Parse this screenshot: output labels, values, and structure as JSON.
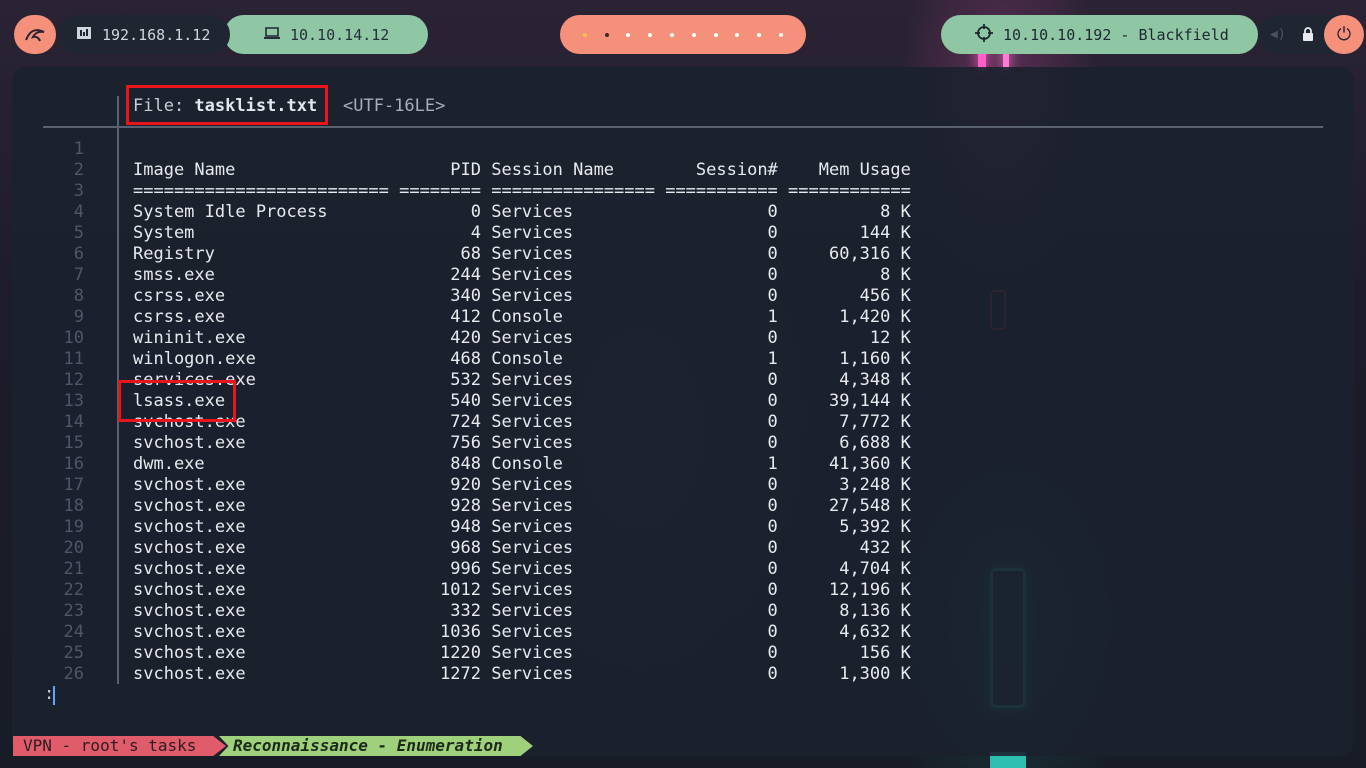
{
  "topbar": {
    "left_ip": "192.168.1.12",
    "vpn_ip": "10.10.14.12",
    "target": "10.10.10.192 - Blackfield",
    "workspaces": [
      "1",
      "2",
      "3",
      "4",
      "5",
      "6",
      "7",
      "8",
      "9",
      "10"
    ],
    "active_workspace": "2"
  },
  "pager": {
    "file_label": "File: ",
    "file_name": "tasklist.txt",
    "encoding": "<UTF-16LE>",
    "prompt": ":"
  },
  "table": {
    "line_numbers": [
      "1",
      "2",
      "3",
      "4",
      "5",
      "6",
      "7",
      "8",
      "9",
      "10",
      "11",
      "12",
      "13",
      "14",
      "15",
      "16",
      "17",
      "18",
      "19",
      "20",
      "21",
      "22",
      "23",
      "24",
      "25",
      "26"
    ],
    "header_line": "Image Name                     PID Session Name        Session#    Mem Usage",
    "separator_line": "========================= ======== ================ =========== ============",
    "rows": [
      {
        "image": "System Idle Process",
        "pid": "0",
        "session": "Services",
        "num": "0",
        "mem": "8 K"
      },
      {
        "image": "System",
        "pid": "4",
        "session": "Services",
        "num": "0",
        "mem": "144 K"
      },
      {
        "image": "Registry",
        "pid": "68",
        "session": "Services",
        "num": "0",
        "mem": "60,316 K"
      },
      {
        "image": "smss.exe",
        "pid": "244",
        "session": "Services",
        "num": "0",
        "mem": "8 K"
      },
      {
        "image": "csrss.exe",
        "pid": "340",
        "session": "Services",
        "num": "0",
        "mem": "456 K"
      },
      {
        "image": "csrss.exe",
        "pid": "412",
        "session": "Console",
        "num": "1",
        "mem": "1,420 K"
      },
      {
        "image": "wininit.exe",
        "pid": "420",
        "session": "Services",
        "num": "0",
        "mem": "12 K"
      },
      {
        "image": "winlogon.exe",
        "pid": "468",
        "session": "Console",
        "num": "1",
        "mem": "1,160 K"
      },
      {
        "image": "services.exe",
        "pid": "532",
        "session": "Services",
        "num": "0",
        "mem": "4,348 K"
      },
      {
        "image": "lsass.exe",
        "pid": "540",
        "session": "Services",
        "num": "0",
        "mem": "39,144 K"
      },
      {
        "image": "svchost.exe",
        "pid": "724",
        "session": "Services",
        "num": "0",
        "mem": "7,772 K"
      },
      {
        "image": "svchost.exe",
        "pid": "756",
        "session": "Services",
        "num": "0",
        "mem": "6,688 K"
      },
      {
        "image": "dwm.exe",
        "pid": "848",
        "session": "Console",
        "num": "1",
        "mem": "41,360 K"
      },
      {
        "image": "svchost.exe",
        "pid": "920",
        "session": "Services",
        "num": "0",
        "mem": "3,248 K"
      },
      {
        "image": "svchost.exe",
        "pid": "928",
        "session": "Services",
        "num": "0",
        "mem": "27,548 K"
      },
      {
        "image": "svchost.exe",
        "pid": "948",
        "session": "Services",
        "num": "0",
        "mem": "5,392 K"
      },
      {
        "image": "svchost.exe",
        "pid": "968",
        "session": "Services",
        "num": "0",
        "mem": "432 K"
      },
      {
        "image": "svchost.exe",
        "pid": "996",
        "session": "Services",
        "num": "0",
        "mem": "4,704 K"
      },
      {
        "image": "svchost.exe",
        "pid": "1012",
        "session": "Services",
        "num": "0",
        "mem": "12,196 K"
      },
      {
        "image": "svchost.exe",
        "pid": "332",
        "session": "Services",
        "num": "0",
        "mem": "8,136 K"
      },
      {
        "image": "svchost.exe",
        "pid": "1036",
        "session": "Services",
        "num": "0",
        "mem": "4,632 K"
      },
      {
        "image": "svchost.exe",
        "pid": "1220",
        "session": "Services",
        "num": "0",
        "mem": "156 K"
      },
      {
        "image": "svchost.exe",
        "pid": "1272",
        "session": "Services",
        "num": "0",
        "mem": "1,300 K"
      }
    ]
  },
  "statusbar": {
    "tab1": "VPN - root's tasks",
    "tab2": "Reconnaissance - Enumeration"
  },
  "colors": {
    "accent_orange": "#f5917a",
    "accent_green": "#8fc7a5",
    "highlight_red": "#e8161c"
  }
}
